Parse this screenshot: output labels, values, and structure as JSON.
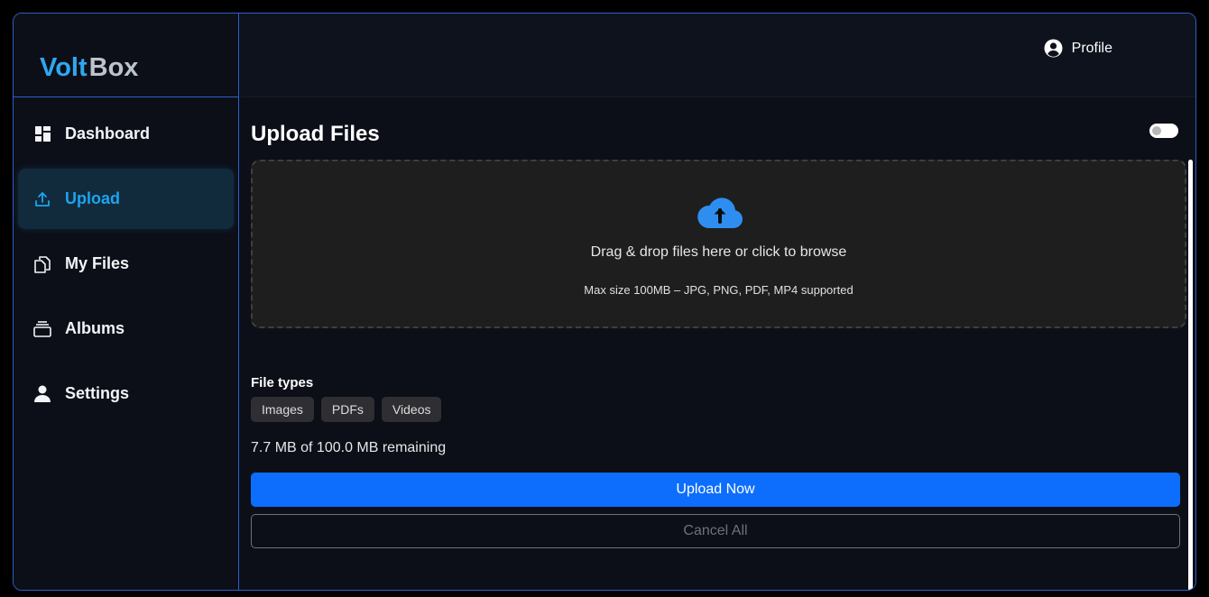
{
  "brand": {
    "part1": "Volt",
    "part2": "Box"
  },
  "header": {
    "profile_label": "Profile"
  },
  "sidebar": {
    "items": [
      {
        "label": "Dashboard",
        "icon": "dashboard-icon",
        "active": false
      },
      {
        "label": "Upload",
        "icon": "upload-icon",
        "active": true
      },
      {
        "label": "My Files",
        "icon": "files-icon",
        "active": false
      },
      {
        "label": "Albums",
        "icon": "albums-icon",
        "active": false
      },
      {
        "label": "Settings",
        "icon": "user-icon",
        "active": false
      }
    ]
  },
  "main": {
    "title": "Upload Files",
    "dropzone": {
      "text": "Drag & drop files here or click to browse",
      "hint": "Max size 100MB – JPG, PNG, PDF, MP4 supported",
      "icon": "cloud-upload-icon"
    },
    "file_types_label": "File types",
    "file_types": [
      "Images",
      "PDFs",
      "Videos"
    ],
    "remaining": "7.7 MB of 100.0 MB remaining",
    "upload_button": "Upload Now",
    "cancel_button": "Cancel All"
  },
  "colors": {
    "accent": "#0d6efd",
    "brand_blue": "#2fa8f0",
    "active_nav": "#1da4ee",
    "border": "#2d5fc9"
  }
}
